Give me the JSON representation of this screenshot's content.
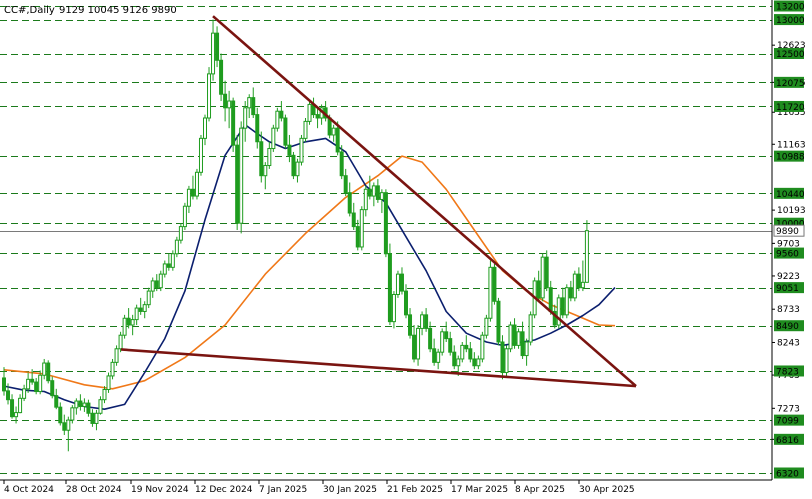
{
  "chart_title": "CC#,Daily",
  "ohlc_readout": "9129 10045 9126 9890",
  "colors": {
    "background": "#ffffff",
    "up_candle": "#1f9c1f",
    "down_candle": "#1f9c1f",
    "fast_ma": "#0b1f6e",
    "slow_ma": "#f07818",
    "trendline": "#7a1410",
    "level_line": "#1b7a1b",
    "tag_fill": "#1f8c1f",
    "current_price_line": "#7a7a7a"
  },
  "chart_data": {
    "type": "candlestick",
    "y_axis": {
      "range": [
        6320,
        13200
      ],
      "tick_labels": [
        "12623",
        "12075",
        "11635",
        "11163",
        "10193",
        "9703",
        "9223",
        "8733",
        "8243",
        "7763",
        "7273",
        "6816"
      ]
    },
    "x_axis": {
      "tick_labels": [
        "4 Oct 2024",
        "28 Oct 2024",
        "19 Nov 2024",
        "12 Dec 2024",
        "7 Jan 2025",
        "30 Jan 2025",
        "21 Feb 2025",
        "17 Mar 2025",
        "8 Apr 2025",
        "30 Apr 2025"
      ]
    },
    "horizontal_levels": [
      13200,
      13000,
      12500,
      12075,
      11720,
      10988,
      10440,
      10000,
      9560,
      9051,
      8490,
      7823,
      7099,
      6816,
      6320
    ],
    "current_price": 9890,
    "trendlines": [
      {
        "name": "descending-resistance",
        "from": {
          "date": "13 Dec 2024",
          "price": 13050
        },
        "to": {
          "date": "26 May 2025",
          "price": 7600
        }
      },
      {
        "name": "descending-support",
        "from": {
          "date": "25 Nov 2024",
          "price": 8140
        },
        "to": {
          "date": "26 May 2025",
          "price": 7600
        }
      }
    ],
    "candles": [
      [
        7720,
        7880,
        7460,
        7530
      ],
      [
        7530,
        7640,
        7330,
        7400
      ],
      [
        7400,
        7480,
        7120,
        7150
      ],
      [
        7150,
        7300,
        7050,
        7210
      ],
      [
        7210,
        7480,
        7200,
        7420
      ],
      [
        7420,
        7620,
        7380,
        7560
      ],
      [
        7560,
        7800,
        7500,
        7700
      ],
      [
        7700,
        7850,
        7620,
        7660
      ],
      [
        7660,
        7720,
        7480,
        7520
      ],
      [
        7520,
        7830,
        7480,
        7760
      ],
      [
        7760,
        8000,
        7700,
        7940
      ],
      [
        7940,
        7980,
        7640,
        7680
      ],
      [
        7680,
        7740,
        7420,
        7460
      ],
      [
        7460,
        7560,
        7260,
        7290
      ],
      [
        7290,
        7360,
        7020,
        7060
      ],
      [
        7060,
        7180,
        6880,
        6950
      ],
      [
        6950,
        7150,
        6640,
        7100
      ],
      [
        7100,
        7320,
        7050,
        7280
      ],
      [
        7280,
        7420,
        7180,
        7380
      ],
      [
        7380,
        7480,
        7240,
        7300
      ],
      [
        7300,
        7420,
        7220,
        7350
      ],
      [
        7350,
        7400,
        7150,
        7200
      ],
      [
        7200,
        7260,
        7000,
        7050
      ],
      [
        7050,
        7250,
        6950,
        7200
      ],
      [
        7200,
        7450,
        7180,
        7400
      ],
      [
        7400,
        7600,
        7350,
        7550
      ],
      [
        7550,
        7800,
        7500,
        7750
      ],
      [
        7750,
        8000,
        7700,
        7950
      ],
      [
        7950,
        8200,
        7900,
        8150
      ],
      [
        8150,
        8400,
        8100,
        8350
      ],
      [
        8350,
        8650,
        8300,
        8600
      ],
      [
        8600,
        8750,
        8450,
        8500
      ],
      [
        8500,
        8650,
        8350,
        8580
      ],
      [
        8580,
        8800,
        8500,
        8750
      ],
      [
        8750,
        8900,
        8650,
        8700
      ],
      [
        8700,
        8850,
        8600,
        8800
      ],
      [
        8800,
        9050,
        8750,
        9000
      ],
      [
        9000,
        9200,
        8900,
        9150
      ],
      [
        9150,
        9250,
        9000,
        9050
      ],
      [
        9050,
        9300,
        9000,
        9250
      ],
      [
        9250,
        9450,
        9200,
        9400
      ],
      [
        9400,
        9550,
        9300,
        9350
      ],
      [
        9350,
        9600,
        9300,
        9550
      ],
      [
        9550,
        9800,
        9500,
        9750
      ],
      [
        9750,
        10000,
        9700,
        9950
      ],
      [
        9950,
        10300,
        9900,
        10250
      ],
      [
        10250,
        10550,
        10150,
        10500
      ],
      [
        10500,
        10700,
        10350,
        10400
      ],
      [
        10400,
        10800,
        10350,
        10750
      ],
      [
        10750,
        11300,
        10700,
        11250
      ],
      [
        11250,
        11600,
        11150,
        11550
      ],
      [
        11550,
        12300,
        11500,
        12200
      ],
      [
        12200,
        13000,
        12100,
        12800
      ],
      [
        12800,
        12900,
        12300,
        12400
      ],
      [
        12400,
        12500,
        11800,
        11900
      ],
      [
        11900,
        12100,
        11500,
        11700
      ],
      [
        11700,
        11950,
        11400,
        11800
      ],
      [
        11800,
        11850,
        11050,
        11150
      ],
      [
        11150,
        11300,
        9900,
        10000
      ],
      [
        10000,
        11500,
        9850,
        11400
      ],
      [
        11400,
        11800,
        11200,
        11700
      ],
      [
        11700,
        11900,
        11550,
        11850
      ],
      [
        11850,
        12000,
        11550,
        11600
      ],
      [
        11600,
        11700,
        11100,
        11200
      ],
      [
        11200,
        11350,
        10600,
        10700
      ],
      [
        10700,
        10900,
        10500,
        10850
      ],
      [
        10850,
        11200,
        10800,
        11100
      ],
      [
        11100,
        11450,
        11050,
        11400
      ],
      [
        11400,
        11700,
        11350,
        11650
      ],
      [
        11650,
        11800,
        11500,
        11550
      ],
      [
        11550,
        11600,
        11100,
        11150
      ],
      [
        11150,
        11300,
        10900,
        11000
      ],
      [
        11000,
        11050,
        10650,
        10700
      ],
      [
        10700,
        10950,
        10600,
        10900
      ],
      [
        10900,
        11300,
        10850,
        11250
      ],
      [
        11250,
        11550,
        11200,
        11500
      ],
      [
        11500,
        11800,
        11450,
        11750
      ],
      [
        11750,
        11850,
        11550,
        11600
      ],
      [
        11600,
        11700,
        11400,
        11550
      ],
      [
        11550,
        11750,
        11450,
        11700
      ],
      [
        11700,
        11800,
        11500,
        11550
      ],
      [
        11550,
        11600,
        11250,
        11300
      ],
      [
        11300,
        11450,
        11200,
        11400
      ],
      [
        11400,
        11500,
        11000,
        11050
      ],
      [
        11050,
        11150,
        10650,
        10700
      ],
      [
        10700,
        10800,
        10400,
        10450
      ],
      [
        10450,
        10600,
        10100,
        10150
      ],
      [
        10150,
        10300,
        9900,
        9950
      ],
      [
        9950,
        10050,
        9600,
        9650
      ],
      [
        9650,
        10250,
        9600,
        10200
      ],
      [
        10200,
        10550,
        10100,
        10500
      ],
      [
        10500,
        10700,
        10350,
        10400
      ],
      [
        10400,
        10600,
        10250,
        10550
      ],
      [
        10550,
        10650,
        10300,
        10350
      ],
      [
        10350,
        10500,
        10150,
        10450
      ],
      [
        10450,
        10500,
        9500,
        9550
      ],
      [
        9550,
        9700,
        8500,
        8550
      ],
      [
        8550,
        9000,
        8450,
        8950
      ],
      [
        8950,
        9300,
        8900,
        9250
      ],
      [
        9250,
        9350,
        8950,
        9000
      ],
      [
        9000,
        9100,
        8600,
        8650
      ],
      [
        8650,
        8750,
        8300,
        8350
      ],
      [
        8350,
        8500,
        7950,
        8000
      ],
      [
        8000,
        8500,
        7900,
        8450
      ],
      [
        8450,
        8700,
        8350,
        8650
      ],
      [
        8650,
        8750,
        8400,
        8450
      ],
      [
        8450,
        8550,
        8100,
        8150
      ],
      [
        8150,
        8300,
        7900,
        7950
      ],
      [
        7950,
        8150,
        7850,
        8100
      ],
      [
        8100,
        8450,
        8050,
        8400
      ],
      [
        8400,
        8550,
        8250,
        8300
      ],
      [
        8300,
        8400,
        8050,
        8100
      ],
      [
        8100,
        8200,
        7850,
        7900
      ],
      [
        7900,
        8050,
        7750,
        8000
      ],
      [
        8000,
        8250,
        7950,
        8200
      ],
      [
        8200,
        8350,
        8100,
        8150
      ],
      [
        8150,
        8250,
        7950,
        8000
      ],
      [
        8000,
        8100,
        7850,
        7900
      ],
      [
        7900,
        8050,
        7850,
        8000
      ],
      [
        8000,
        8400,
        7950,
        8350
      ],
      [
        8350,
        8650,
        8300,
        8600
      ],
      [
        8600,
        9450,
        8550,
        9350
      ],
      [
        9350,
        9400,
        8800,
        8850
      ],
      [
        8850,
        8900,
        8200,
        8250
      ],
      [
        8250,
        8350,
        7700,
        7800
      ],
      [
        7800,
        8200,
        7750,
        8150
      ],
      [
        8150,
        8550,
        8100,
        8500
      ],
      [
        8500,
        8600,
        8150,
        8200
      ],
      [
        8200,
        8450,
        8150,
        8400
      ],
      [
        8400,
        8550,
        8000,
        8050
      ],
      [
        8050,
        8300,
        7900,
        8250
      ],
      [
        8250,
        8700,
        8200,
        8650
      ],
      [
        8650,
        9200,
        8600,
        9150
      ],
      [
        9150,
        9300,
        8850,
        8900
      ],
      [
        8900,
        9550,
        8850,
        9500
      ],
      [
        9500,
        9600,
        9000,
        9050
      ],
      [
        9050,
        9150,
        8650,
        8700
      ],
      [
        8700,
        8800,
        8450,
        8500
      ],
      [
        8500,
        8950,
        8450,
        8900
      ],
      [
        8900,
        9050,
        8600,
        8650
      ],
      [
        8650,
        9100,
        8600,
        9050
      ],
      [
        9050,
        9150,
        8850,
        8900
      ],
      [
        8900,
        9300,
        8850,
        9250
      ],
      [
        9250,
        9350,
        9000,
        9050
      ],
      [
        9050,
        9450,
        9000,
        9129
      ],
      [
        9129,
        10045,
        9126,
        9890
      ]
    ],
    "fast_ma": [
      [
        0,
        7600
      ],
      [
        5,
        7540
      ],
      [
        10,
        7520
      ],
      [
        15,
        7400
      ],
      [
        20,
        7300
      ],
      [
        25,
        7260
      ],
      [
        30,
        7330
      ],
      [
        35,
        7800
      ],
      [
        40,
        8300
      ],
      [
        45,
        9000
      ],
      [
        50,
        10050
      ],
      [
        55,
        11000
      ],
      [
        60,
        11450
      ],
      [
        63,
        11320
      ],
      [
        66,
        11200
      ],
      [
        70,
        11100
      ],
      [
        75,
        11200
      ],
      [
        80,
        11250
      ],
      [
        85,
        11050
      ],
      [
        90,
        10550
      ],
      [
        95,
        10300
      ],
      [
        100,
        9800
      ],
      [
        105,
        9300
      ],
      [
        110,
        8700
      ],
      [
        115,
        8380
      ],
      [
        120,
        8250
      ],
      [
        124,
        8200
      ],
      [
        128,
        8240
      ],
      [
        132,
        8280
      ],
      [
        136,
        8380
      ],
      [
        140,
        8500
      ],
      [
        144,
        8640
      ],
      [
        148,
        8800
      ],
      [
        152,
        9051
      ]
    ],
    "slow_ma": [
      [
        0,
        7840
      ],
      [
        10,
        7780
      ],
      [
        20,
        7620
      ],
      [
        27,
        7560
      ],
      [
        35,
        7680
      ],
      [
        45,
        8020
      ],
      [
        55,
        8500
      ],
      [
        65,
        9250
      ],
      [
        75,
        9850
      ],
      [
        85,
        10380
      ],
      [
        93,
        10700
      ],
      [
        99,
        10988
      ],
      [
        104,
        10900
      ],
      [
        110,
        10500
      ],
      [
        117,
        9900
      ],
      [
        124,
        9300
      ],
      [
        130,
        9000
      ],
      [
        136,
        8800
      ],
      [
        142,
        8650
      ],
      [
        148,
        8500
      ],
      [
        152,
        8490
      ]
    ]
  }
}
